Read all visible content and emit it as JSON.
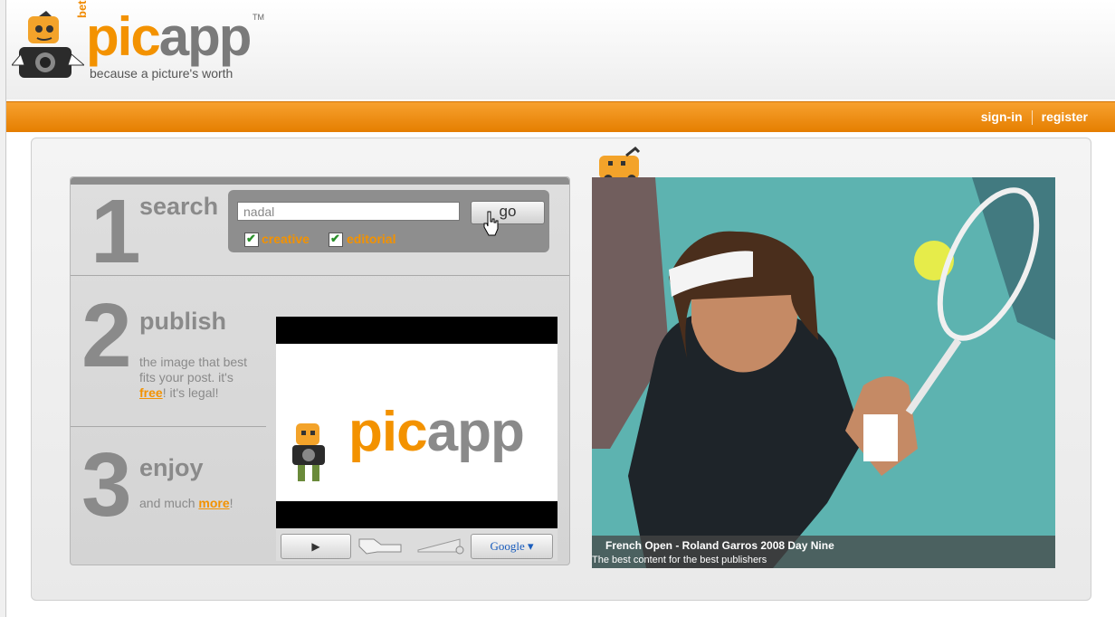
{
  "header": {
    "logo_beta": "beta",
    "logo_pic": "pic",
    "logo_app": "app",
    "logo_tm": "TM",
    "tagline": "because a picture's worth"
  },
  "nav": {
    "signin": "sign-in",
    "register": "register"
  },
  "steps": [
    {
      "number": "1",
      "title": "search"
    },
    {
      "number": "2",
      "title": "publish",
      "desc_line1": "the image that best",
      "desc_line2": "fits your post. it's",
      "desc_free": "free",
      "desc_tail": "! it's legal!"
    },
    {
      "number": "3",
      "title": "enjoy",
      "desc_pre": "and much ",
      "desc_more": "more",
      "desc_post": "!"
    }
  ],
  "search": {
    "value": "nadal",
    "go_label": "go",
    "filters": [
      {
        "label": "creative",
        "checked": true
      },
      {
        "label": "editorial",
        "checked": true
      }
    ]
  },
  "video": {
    "logo_pic": "pic",
    "logo_app": "app",
    "play_symbol": "▶",
    "google_label": "Google ▾"
  },
  "feature": {
    "caption_title": "French Open - Roland Garros 2008 Day Nine",
    "caption_sub": "The best content for the best publishers"
  },
  "colors": {
    "accent": "#f39200",
    "bar": "#e57e00",
    "text_gray": "#8a8a8a"
  }
}
